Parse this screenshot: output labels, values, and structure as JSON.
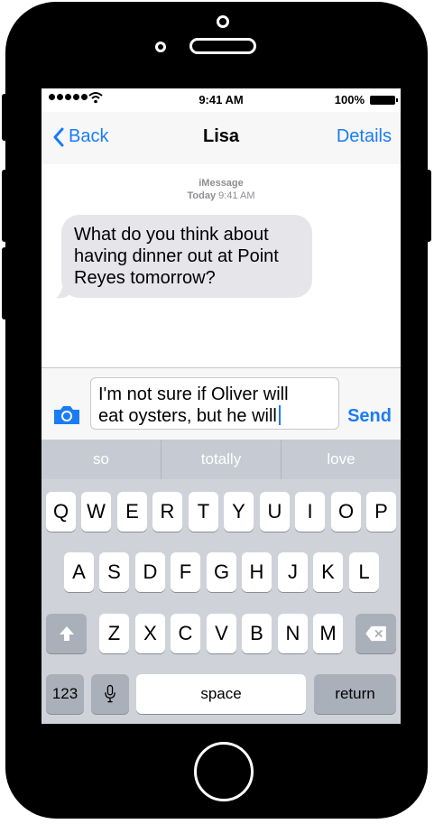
{
  "status_bar": {
    "time": "9:41 AM",
    "battery": "100%"
  },
  "nav": {
    "back_label": "Back",
    "title": "Lisa",
    "details_label": "Details"
  },
  "conversation": {
    "service": "iMessage",
    "date": "Today",
    "time": "9:41 AM",
    "incoming_message": "What do you think about having dinner out at Point Reyes tomorrow?"
  },
  "composer": {
    "text_line1": "I'm not sure if Oliver will",
    "text_line2": "eat oysters, but he will",
    "send_label": "Send"
  },
  "keyboard": {
    "suggestions": [
      "so",
      "totally",
      "love"
    ],
    "row1": [
      "Q",
      "W",
      "E",
      "R",
      "T",
      "Y",
      "U",
      "I",
      "O",
      "P"
    ],
    "row2": [
      "A",
      "S",
      "D",
      "F",
      "G",
      "H",
      "J",
      "K",
      "L"
    ],
    "row3": [
      "Z",
      "X",
      "C",
      "V",
      "B",
      "N",
      "M"
    ],
    "numbers_label": "123",
    "space_label": "space",
    "return_label": "return"
  },
  "icons": [
    "wifi-icon",
    "battery-icon",
    "chevron-left-icon",
    "camera-icon",
    "shift-icon",
    "backspace-icon",
    "microphone-icon"
  ],
  "colors": {
    "accent": "#1a7cf5",
    "bubble": "#e5e5ea",
    "keyboard_bg": "#cfd3d9"
  }
}
